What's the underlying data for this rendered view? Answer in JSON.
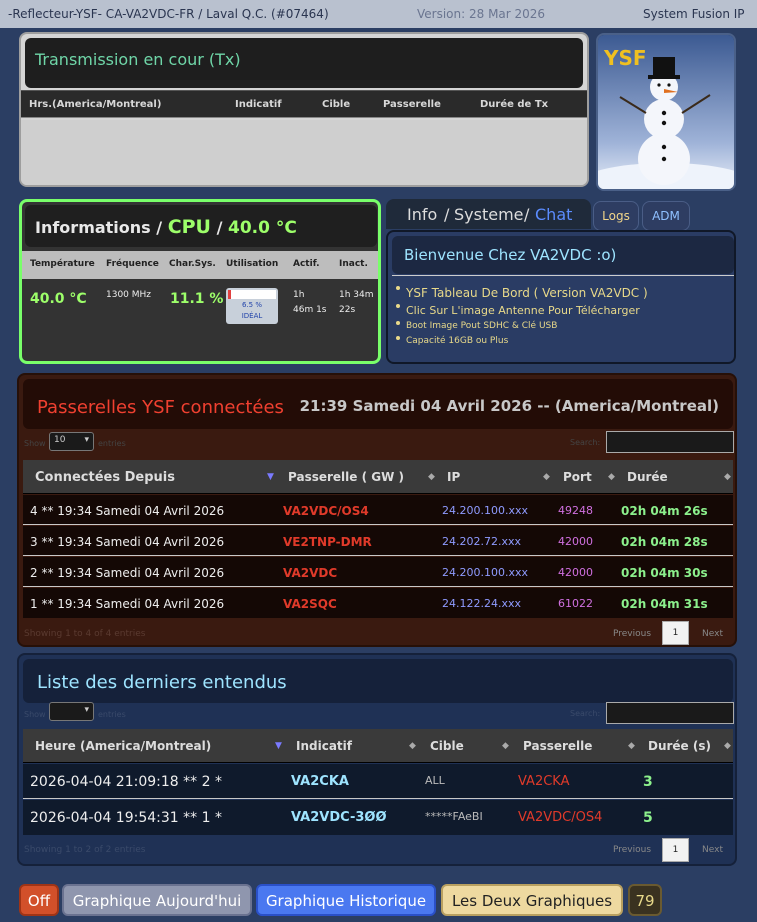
{
  "topbar": {
    "title": "-Reflecteur-YSF- CA-VA2VDC-FR / Laval Q.C. (#07464)",
    "version": "Version: 28 Mar 2026",
    "system": "System Fusion IP"
  },
  "tx": {
    "title": "Transmission en cour (Tx)",
    "columns": [
      "Hrs.(America/Montreal)",
      "Indicatif",
      "Cible",
      "Passerelle",
      "Durée de Tx"
    ]
  },
  "logo": {
    "text": "YSF"
  },
  "cpu": {
    "title_a": "Informations /",
    "title_b": "CPU",
    "title_c": "/",
    "title_d": "40.0 °C",
    "columns": [
      "Température",
      "Fréquence",
      "Char.Sys.",
      "Utilisation",
      "Actif.",
      "Inact."
    ],
    "temperature": "40.0 °C",
    "frequency": "1300 MHz",
    "load": "11.1 %",
    "usage_percent": "6.5 %",
    "usage_fraction": 0.065,
    "usage_label": "IDÉAL",
    "active_1": "1h",
    "active_2": "46m 1s",
    "inactive_1": "1h 34m",
    "inactive_2": "22s"
  },
  "info": {
    "tab_info": "Info",
    "tab_sep1": "/",
    "tab_system": "Systeme",
    "tab_sep2": "/",
    "tab_chat": "Chat",
    "btn_logs": "Logs",
    "btn_adm": "ADM",
    "title": "Bienvenue Chez VA2VDC :o)",
    "items": [
      "YSF Tableau De Bord ( Version VA2VDC )",
      "Clic Sur L'image Antenne Pour Télécharger",
      "Boot Image Pout SDHC & Clé USB",
      "Capacité 16GB ou Plus"
    ]
  },
  "gateways": {
    "title": "Passerelles YSF connectées",
    "clock": "21:39 Samedi 04 Avril 2026 -- (America/Montreal)",
    "show_label": "Show",
    "entries_label": "entries",
    "page_size": "10",
    "search_label": "Search:",
    "columns": [
      "Connectées Depuis",
      "Passerelle ( GW )",
      "IP",
      "Port",
      "Durée"
    ],
    "rows": [
      {
        "since": "4 ** 19:34 Samedi 04 Avril 2026",
        "gw": "VA2VDC/OS4",
        "ip": "24.200.100.xxx",
        "port": "49248",
        "dur": "02h 04m 26s"
      },
      {
        "since": "3 ** 19:34 Samedi 04 Avril 2026",
        "gw": "VE2TNP-DMR",
        "ip": "24.202.72.xxx",
        "port": "42000",
        "dur": "02h 04m 28s"
      },
      {
        "since": "2 ** 19:34 Samedi 04 Avril 2026",
        "gw": "VA2VDC",
        "ip": "24.200.100.xxx",
        "port": "42000",
        "dur": "02h 04m 30s"
      },
      {
        "since": "1 ** 19:34 Samedi 04 Avril 2026",
        "gw": "VA2SQC",
        "ip": "24.122.24.xxx",
        "port": "61022",
        "dur": "02h 04m 31s"
      }
    ],
    "info": "Showing 1 to 4 of 4 entries",
    "prev": "Previous",
    "page": "1",
    "next": "Next"
  },
  "heard": {
    "title": "Liste des derniers entendus",
    "show_label": "Show",
    "entries_label": "entries",
    "search_label": "Search:",
    "columns": [
      "Heure (America/Montreal)",
      "Indicatif",
      "Cible",
      "Passerelle",
      "Durée (s)"
    ],
    "rows": [
      {
        "time": "2026-04-04 21:09:18 ** 2 *",
        "call": "VA2CKA",
        "target": "ALL",
        "gw": "VA2CKA",
        "dur": "3"
      },
      {
        "time": "2026-04-04 19:54:31 ** 1 *",
        "call": "VA2VDC-3ØØ",
        "target": "*****FAeBI",
        "gw": "VA2VDC/OS4",
        "dur": "5"
      }
    ],
    "info": "Showing 1 to 2 of 2 entries",
    "prev": "Previous",
    "page": "1",
    "next": "Next"
  },
  "buttons": {
    "off": "Off",
    "today": "Graphique Aujourd'hui",
    "history": "Graphique Historique",
    "both": "Les Deux Graphiques",
    "count": "79"
  }
}
